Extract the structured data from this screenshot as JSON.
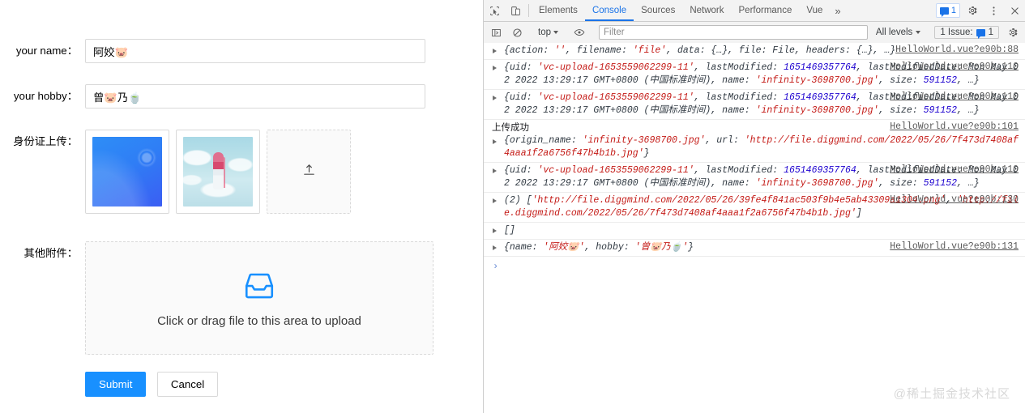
{
  "form": {
    "fields": [
      {
        "label": "your name：",
        "value": "阿姣🐷",
        "placeholder": ""
      },
      {
        "label": "your hobby：",
        "value": "曾🐷乃🍵",
        "placeholder": ""
      }
    ],
    "id_upload": {
      "label": "身份证上传：",
      "add_icon": "upload-icon",
      "items": [
        {
          "name": "id-photo-1",
          "alt": "blue gradient image"
        },
        {
          "name": "id-photo-2",
          "alt": "anime girl in clouds image"
        }
      ]
    },
    "attachments": {
      "label": "其他附件：",
      "icon": "inbox-icon",
      "hint": "Click or drag file to this area to upload"
    },
    "actions": {
      "submit_label": "Submit",
      "cancel_label": "Cancel"
    }
  },
  "devtools": {
    "tabbar": {
      "inspect_icon": "cursor-select-icon",
      "device_icon": "device-toggle-icon",
      "tabs": [
        {
          "label": "Elements",
          "active": false
        },
        {
          "label": "Console",
          "active": true
        },
        {
          "label": "Sources",
          "active": false
        },
        {
          "label": "Network",
          "active": false
        },
        {
          "label": "Performance",
          "active": false
        },
        {
          "label": "Vue",
          "active": false
        }
      ],
      "overflow_label": "»",
      "message_count": "1",
      "settings_icon": "gear-icon",
      "kebab_icon": "more-vertical-icon",
      "close_icon": "close-icon"
    },
    "toolbar": {
      "sidebar_icon": "console-sidebar-icon",
      "clear_icon": "clear-console-icon",
      "context_label": "top",
      "eye_icon": "live-expression-icon",
      "filter_placeholder": "Filter",
      "filter_value": "",
      "levels_label": "All levels",
      "issues_label": "1 Issue:",
      "issues_count": "1",
      "settings_icon": "gear-icon"
    },
    "console": {
      "prompt": "›",
      "messages": [
        {
          "id": "msg-1",
          "anchor": "HelloWorld.vue?e90b:88",
          "expandable": true,
          "label": "",
          "body_html": "{action: <span class=\"s-str\">''</span>, filename: <span class=\"s-str\">'file'</span>, data: {…}, file: File, headers: {…}, …}",
          "body_text": "{action: '', filename: 'file', data: {…}, file: File, headers: {…}, …}"
        },
        {
          "id": "msg-2",
          "anchor": "HelloWorld.vue?e90b:110",
          "expandable": true,
          "label": "",
          "body_html": "{uid: <span class=\"s-str\">'vc-upload-1653559062299-11'</span>, lastModified: <span class=\"s-num\">1651469357764</span>, lastModifiedDate: Mon May 02 2022 13:29:17 GMT+0800 (中国标准时间), name: <span class=\"s-str\">'infinity-3698700.jpg'</span>, size: <span class=\"s-num\">591152</span>, …}",
          "body_text": "{uid: 'vc-upload-1653559062299-11', lastModified: 1651469357764, lastModifiedDate: Mon May 02 2022 13:29:17 GMT+0800 (中国标准时间), name: 'infinity-3698700.jpg', size: 591152, …}"
        },
        {
          "id": "msg-3",
          "anchor": "HelloWorld.vue?e90b:110",
          "expandable": true,
          "label": "",
          "body_html": "{uid: <span class=\"s-str\">'vc-upload-1653559062299-11'</span>, lastModified: <span class=\"s-num\">1651469357764</span>, lastModifiedDate: Mon May 02 2022 13:29:17 GMT+0800 (中国标准时间), name: <span class=\"s-str\">'infinity-3698700.jpg'</span>, size: <span class=\"s-num\">591152</span>, …}",
          "body_text": "{uid: 'vc-upload-1653559062299-11', lastModified: 1651469357764, lastModifiedDate: Mon May 02 2022 13:29:17 GMT+0800 (中国标准时间), name: 'infinity-3698700.jpg', size: 591152, …}"
        },
        {
          "id": "msg-4",
          "anchor": "HelloWorld.vue?e90b:101",
          "expandable": true,
          "label": "上传成功",
          "body_html": "{origin_name: <span class=\"s-str\">'infinity-3698700.jpg'</span>, url: <span class=\"s-str\">'http://file.diggmind.com/2022/05/26/7f473d7408af4aaa1f2a6756f47b4b1b.jpg'</span>}",
          "body_text": "{origin_name: 'infinity-3698700.jpg', url: 'http://file.diggmind.com/2022/05/26/7f473d7408af4aaa1f2a6756f47b4b1b.jpg'}"
        },
        {
          "id": "msg-5",
          "anchor": "HelloWorld.vue?e90b:110",
          "expandable": true,
          "label": "",
          "body_html": "{uid: <span class=\"s-str\">'vc-upload-1653559062299-11'</span>, lastModified: <span class=\"s-num\">1651469357764</span>, lastModifiedDate: Mon May 02 2022 13:29:17 GMT+0800 (中国标准时间), name: <span class=\"s-str\">'infinity-3698700.jpg'</span>, size: <span class=\"s-num\">591152</span>, …}",
          "body_text": "{uid: 'vc-upload-1653559062299-11', lastModified: 1651469357764, lastModifiedDate: Mon May 02 2022 13:29:17 GMT+0800 (中国标准时间), name: 'infinity-3698700.jpg', size: 591152, …}"
        },
        {
          "id": "msg-6",
          "anchor": "HelloWorld.vue?e90b:130",
          "expandable": true,
          "label": "",
          "body_html": "(2) [<span class=\"s-str\">'http://file.diggmind.com/2022/05/26/39fe4f841ac503f9b4e5ab43309a1304.png'</span>, <span class=\"s-str\">'http://file.diggmind.com/2022/05/26/7f473d7408af4aaa1f2a6756f47b4b1b.jpg'</span>]",
          "body_text": "(2) ['http://file.diggmind.com/2022/05/26/39fe4f841ac503f9b4e5ab43309a1304.png', 'http://file.diggmind.com/2022/05/26/7f473d7408af4aaa1f2a6756f47b4b1b.jpg']"
        },
        {
          "id": "msg-7",
          "anchor": "",
          "expandable": true,
          "label": "",
          "body_html": "[]",
          "body_text": "[]"
        },
        {
          "id": "msg-8",
          "anchor": "HelloWorld.vue?e90b:131",
          "expandable": true,
          "label": "",
          "body_html": "{name: <span class=\"s-str\">'阿姣🐷'</span>, hobby: <span class=\"s-str\">'曾🐷乃🍵'</span>}",
          "body_text": "{name: '阿姣🐷', hobby: '曾🐷乃🍵'}"
        }
      ]
    }
  },
  "watermark": "@稀土掘金技术社区",
  "colors": {
    "primary": "#1890ff",
    "devtools_accent": "#1a73e8",
    "string_red": "#c41a16",
    "number_blue": "#1c00cf",
    "border_gray": "#d9d9d9",
    "toolbar_bg": "#f3f3f3"
  }
}
